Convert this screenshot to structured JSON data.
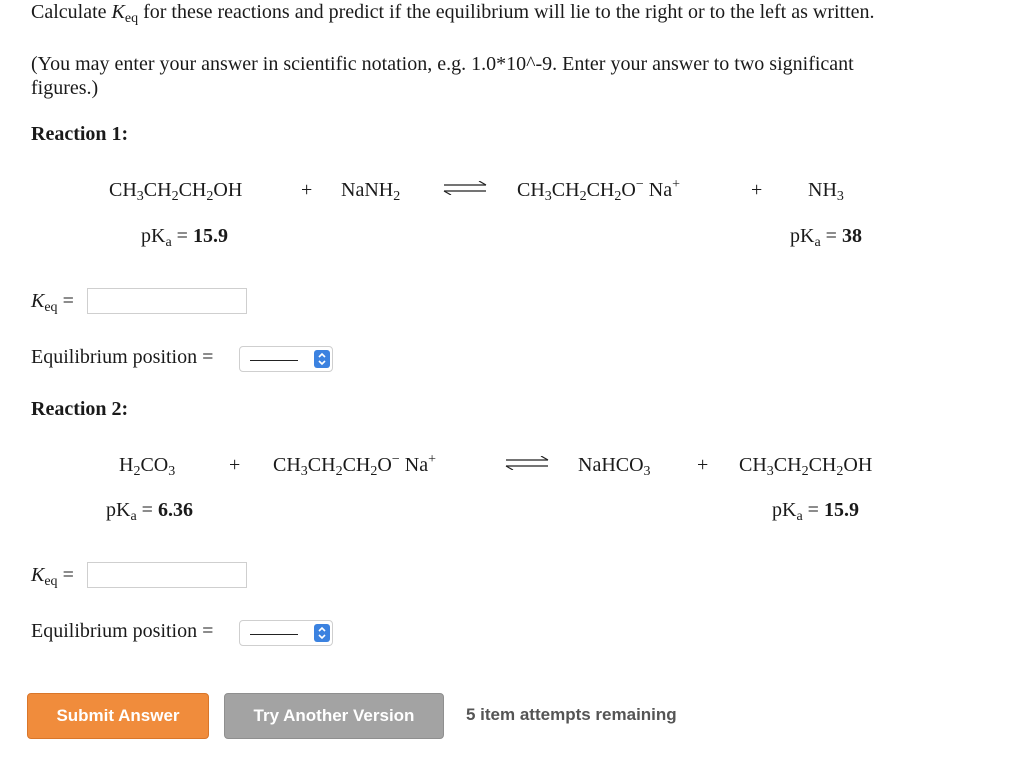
{
  "instructions": {
    "line1_a": "Calculate ",
    "keq_K": "K",
    "keq_sub": "eq",
    "line1_b": " for these reactions and predict if the equilibrium will lie to the right or to the left as written.",
    "line2": "(You may enter your answer in scientific notation, e.g. 1.0*10^-9. Enter your answer to two significant",
    "line3": "figures.)"
  },
  "reaction1": {
    "heading": "Reaction 1:",
    "reactant1": [
      "CH",
      "3",
      "CH",
      "2",
      "CH",
      "2",
      "OH"
    ],
    "plus": "+",
    "reactant2": [
      "NaNH",
      "2"
    ],
    "product1": [
      "CH",
      "3",
      "CH",
      "2",
      "CH",
      "2",
      "O",
      "−",
      "Na",
      "+"
    ],
    "product2": [
      "NH",
      "3"
    ],
    "pka_left": "15.9",
    "pka_right": "38",
    "keq_value": "",
    "position_value": ""
  },
  "reaction2": {
    "heading": "Reaction 2:",
    "reactant1": [
      "H",
      "2",
      "CO",
      "3"
    ],
    "plus": "+",
    "reactant2": [
      "CH",
      "3",
      "CH",
      "2",
      "CH",
      "2",
      "O",
      "−",
      "Na",
      "+"
    ],
    "product1": [
      "NaHCO",
      "3"
    ],
    "product2": [
      "CH",
      "3",
      "CH",
      "2",
      "CH",
      "2",
      "OH"
    ],
    "pka_left": "6.36",
    "pka_right": "15.9",
    "keq_value": "",
    "position_value": ""
  },
  "labels": {
    "pK": "pK",
    "pK_sub": "a",
    "equals": " = ",
    "keq_K": "K",
    "keq_sub": "eq",
    "keq_eq": " =",
    "equilibrium_position": "Equilibrium position ="
  },
  "buttons": {
    "submit": "Submit Answer",
    "try_another": "Try Another Version"
  },
  "attempts_text": "5 item attempts remaining",
  "colors": {
    "submit_bg": "#f08c3c",
    "try_bg": "#a3a3a3",
    "select_accent": "#3b82e0"
  }
}
